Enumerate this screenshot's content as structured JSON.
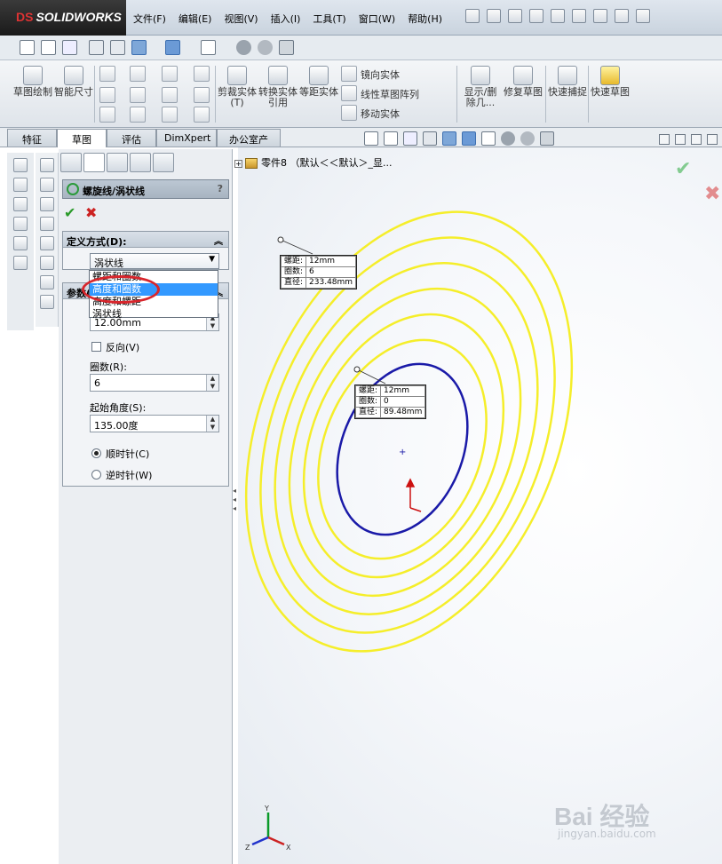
{
  "app": {
    "logo": "SOLIDWORKS"
  },
  "menu": [
    "文件(F)",
    "编辑(E)",
    "视图(V)",
    "插入(I)",
    "工具(T)",
    "窗口(W)",
    "帮助(H)"
  ],
  "commands": {
    "sketch": "草图绘制",
    "smart_dim": "智能尺寸",
    "trim": "剪裁实体(T)",
    "convert": "转换实体引用",
    "offset": "等距实体",
    "mirror": "镜向实体",
    "linear_pattern": "线性草图阵列",
    "move": "移动实体",
    "show_delete": "显示/删除几...",
    "repair": "修复草图",
    "quick_snap": "快速捕捉",
    "quick_sketch": "快速草图"
  },
  "tabs": [
    "特征",
    "草图",
    "评估",
    "DimXpert",
    "办公室产品"
  ],
  "active_tab": "草图",
  "tree": {
    "node": "零件8 （默认＜＜默认＞_显..."
  },
  "property_manager": {
    "title": "螺旋线/涡状线",
    "help": "?",
    "definition_group": "定义方式(D):",
    "definition_value": "涡状线",
    "dropdown_items": [
      "螺距和圈数",
      "高度和圈数",
      "高度和螺距",
      "涡状线"
    ],
    "dropdown_highlight": 1,
    "param_group": "参数(P)",
    "pitch_value": "12.00mm",
    "reverse_label": "反向(V)",
    "revolutions_label": "圈数(R):",
    "revolutions_value": "6",
    "start_angle_label": "起始角度(S):",
    "start_angle_value": "135.00度",
    "clockwise_label": "顺时针(C)",
    "counterclockwise_label": "逆时针(W)",
    "clockwise_selected": true
  },
  "callouts": [
    {
      "labels": [
        "螺距:",
        "圈数:",
        "直径:"
      ],
      "values": [
        "12mm",
        "6",
        "233.48mm"
      ]
    },
    {
      "labels": [
        "螺距:",
        "圈数:",
        "直径:"
      ],
      "values": [
        "12mm",
        "0",
        "89.48mm"
      ]
    }
  ],
  "triad": {
    "x": "X",
    "y": "Y",
    "z": "Z"
  },
  "colors": {
    "spiral": "#f5ee2a",
    "base_circle": "#1a1aa8",
    "highlight": "#3399ff",
    "mark": "#d8262c"
  },
  "watermark": {
    "brand": "Bai 经验",
    "url": "jingyan.baidu.com"
  }
}
